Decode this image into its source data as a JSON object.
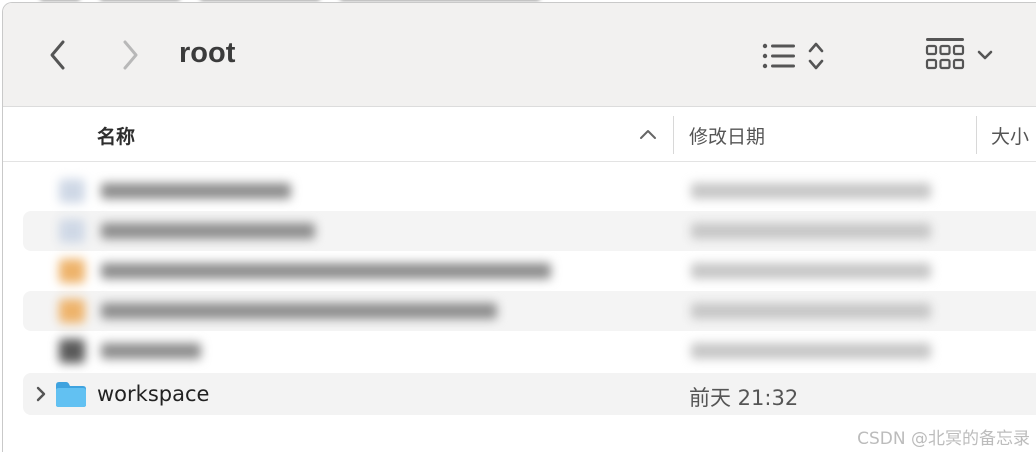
{
  "toolbar": {
    "title": "root",
    "back_icon": "chevron-left-icon",
    "forward_icon": "chevron-right-icon",
    "view_icon": "list-view-icon",
    "sort_icon": "up-down-chevron-icon",
    "group_icon": "icon-grid-icon",
    "group_menu_icon": "chevron-down-icon"
  },
  "columns": {
    "name": "名称",
    "modified": "修改日期",
    "size": "大小"
  },
  "files": [
    {
      "name": "workspace",
      "modified": "前天 21:32",
      "kind": "folder"
    }
  ],
  "colors": {
    "accent_folder": "#4fb3ea",
    "toolbar_bg": "#f2f1f0"
  },
  "watermark": "CSDN @北冥的备忘录"
}
